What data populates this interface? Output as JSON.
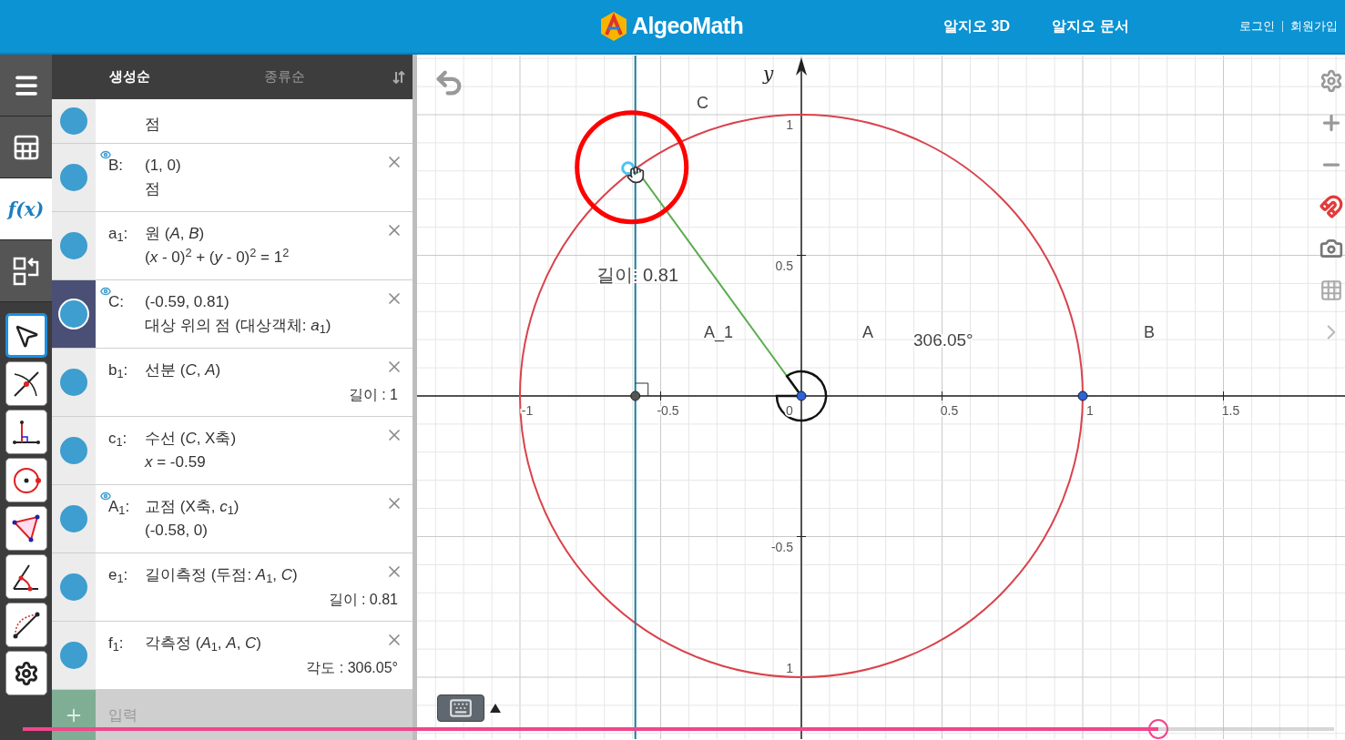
{
  "header": {
    "logo": "AlgeoMath",
    "nav": [
      "알지오 3D",
      "알지오 문서"
    ],
    "auth": [
      "로그인",
      "회원가입"
    ]
  },
  "sidebar": {
    "tabs": [
      {
        "kind": "menu",
        "selected": false
      },
      {
        "kind": "table",
        "selected": false
      },
      {
        "kind": "algebra",
        "label": "f(x)",
        "selected": true
      },
      {
        "kind": "layout",
        "selected": false
      }
    ],
    "tools": [
      {
        "kind": "pointer",
        "selected": true
      },
      {
        "kind": "intersect",
        "selected": false
      },
      {
        "kind": "perpendicular",
        "selected": false
      },
      {
        "kind": "circle",
        "selected": false
      },
      {
        "kind": "polygon",
        "selected": false
      },
      {
        "kind": "angle",
        "selected": false
      },
      {
        "kind": "length",
        "selected": false
      },
      {
        "kind": "settings",
        "selected": false
      }
    ]
  },
  "algebra": {
    "sort_tabs": [
      {
        "label": "생성순",
        "selected": true
      },
      {
        "label": "종류순",
        "selected": false
      }
    ],
    "rows": [
      {
        "line2": "점",
        "kind": "description",
        "visible": false,
        "selected": false
      },
      {
        "label": "B:",
        "line1": "(1, 0)",
        "line2": "점",
        "kind": "description",
        "visible": true,
        "selected": false
      },
      {
        "label": "a$_{1}$:",
        "line1": "원 (*A*, *B*)",
        "line2": "(*x* - 0)$^{2}$ + (*y* - 0)$^{2}$ = 1$^{2}$",
        "kind": "description",
        "visible": false,
        "selected": false
      },
      {
        "label": "C:",
        "line1": "(-0.59, 0.81)",
        "line2": "대상 위의 점 (대상객체: *a*$_{1}$)",
        "kind": "description",
        "visible": true,
        "selected": true
      },
      {
        "label": "b$_{1}$:",
        "line1": "선분 (*C*, *A*)",
        "line2": "길이 : 1",
        "kind": "measure",
        "visible": false,
        "selected": false
      },
      {
        "label": "c$_{1}$:",
        "line1": "수선 (*C*, X축)",
        "line2": "*x* = -0.59",
        "kind": "description",
        "visible": false,
        "selected": false
      },
      {
        "label": "A$_{1}$:",
        "line1": "교점 (X축, *c*$_{1}$)",
        "line2": "(-0.58, 0)",
        "kind": "description",
        "visible": true,
        "selected": false
      },
      {
        "label": "e$_{1}$:",
        "line1": "길이측정 (두점: *A*$_{1}$, *C*)",
        "line2": "길이 : 0.81",
        "kind": "measure",
        "visible": false,
        "selected": false
      },
      {
        "label": "f$_{1}$:",
        "line1": "각측정 (*A*$_{1}$, *A*, *C*)",
        "line2": "각도 : 306.05°",
        "kind": "measure",
        "visible": false,
        "selected": false
      }
    ],
    "input": {
      "placeholder": "입력"
    }
  },
  "canvas": {
    "axis_label": "y",
    "x_ticks": [
      "-1",
      "-0.5",
      "0",
      "0.5",
      "1",
      "1.5"
    ],
    "y_ticks": [
      "1",
      "0.5",
      "-0.5",
      "1"
    ],
    "point_labels": [
      "C",
      "A_1",
      "A",
      "B"
    ],
    "measures": [
      "길이: 0.81",
      "306.05°"
    ]
  },
  "video": {
    "progress": {
      "level": 0.866
    }
  }
}
